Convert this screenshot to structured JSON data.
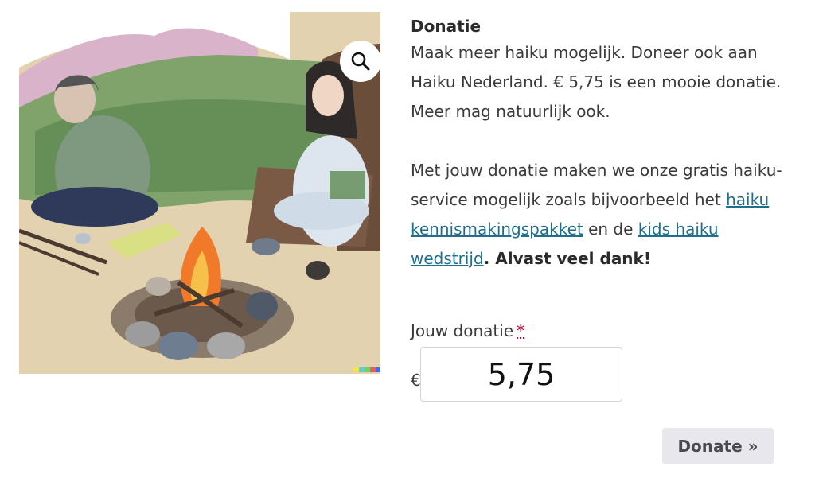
{
  "product": {
    "image_alt": "",
    "zoom_icon": "magnifier-icon"
  },
  "summary": {
    "title": "Donatie",
    "paragraph1": "Maak meer haiku mogelijk. Doneer ook aan Haiku Nederland. € 5,75 is een mooie donatie. Meer mag natuurlijk ook.",
    "p2_text_before": "Met jouw donatie maken we onze gratis haiku-service mogelijk zoals bijvoorbeeld het ",
    "link1": "haiku kennismakingspakket",
    "p2_text_between": " en de ",
    "link2": "kids haiku wedstrijd",
    "p2_bold": ". Alvast veel dank!"
  },
  "donation": {
    "label": "Jouw donatie",
    "required_mark": "*",
    "currency": "€",
    "amount": "5,75"
  },
  "actions": {
    "donate_label": "Donate »"
  },
  "colors": {
    "link": "#1f6f8b",
    "button_bg": "#e8e7ec",
    "required": "#cc0033"
  }
}
